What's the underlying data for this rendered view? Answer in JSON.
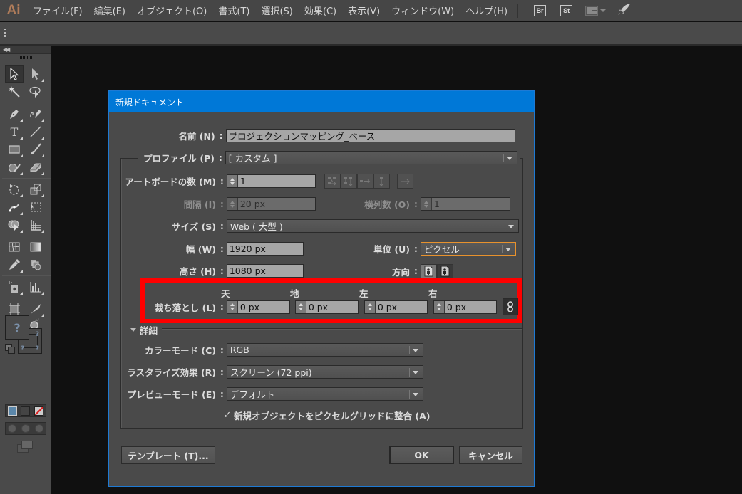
{
  "menubar": {
    "app_logo": "Ai",
    "items": [
      "ファイル(F)",
      "編集(E)",
      "オブジェクト(O)",
      "書式(T)",
      "選択(S)",
      "効果(C)",
      "表示(V)",
      "ウィンドウ(W)",
      "ヘルプ(H)"
    ],
    "bridge_label": "Br",
    "stock_label": "St"
  },
  "tools": {
    "fill_unknown": "?",
    "stroke_unknown": "?"
  },
  "dialog": {
    "title": "新規ドキュメント",
    "name_label": "名前 (N)",
    "name_value": "プロジェクションマッピング_ベース",
    "profile_label": "プロファイル (P)",
    "profile_value": "[ カスタム ]",
    "artboards_label": "アートボードの数 (M)",
    "artboards_value": "1",
    "spacing_label": "間隔 (I)",
    "spacing_value": "20 px",
    "columns_label": "横列数 (O)",
    "columns_value": "1",
    "size_label": "サイズ (S)",
    "size_value": "Web ( 大型 )",
    "width_label": "幅 (W)",
    "width_value": "1920 px",
    "units_label": "単位 (U)",
    "units_value": "ピクセル",
    "height_label": "高さ (H)",
    "height_value": "1080 px",
    "orientation_label": "方向",
    "bleed": {
      "label": "裁ち落とし (L)",
      "top_label": "天",
      "bottom_label": "地",
      "left_label": "左",
      "right_label": "右",
      "top_value": "0 px",
      "bottom_value": "0 px",
      "left_value": "0 px",
      "right_value": "0 px"
    },
    "advanced_label": "詳細",
    "color_mode_label": "カラーモード (C)",
    "color_mode_value": "RGB",
    "raster_label": "ラスタライズ効果 (R)",
    "raster_value": "スクリーン (72 ppi)",
    "preview_label": "プレビューモード (E)",
    "preview_value": "デフォルト",
    "align_pixel_label": "新規オブジェクトをピクセルグリッドに整合 (A)",
    "align_pixel_checked": true,
    "templates_button": "テンプレート (T)...",
    "ok_button": "OK",
    "cancel_button": "キャンセル",
    "colon": ":"
  },
  "colors": {
    "title_bar": "#0078d7",
    "highlight_box": "#ff0000",
    "focus_border": "#e8922d",
    "app_logo": "#b07c5a"
  }
}
